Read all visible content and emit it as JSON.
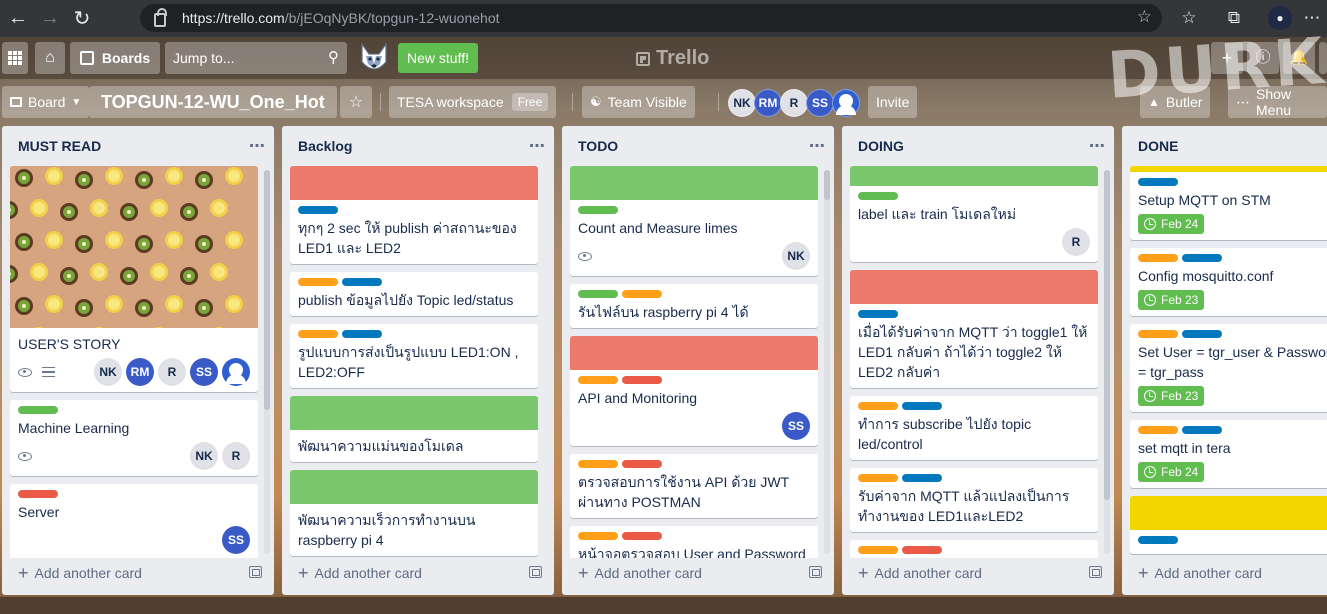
{
  "browser": {
    "url_host": "https://trello.com",
    "url_path": "/b/jEOqNyBK/topgun-12-wuonehot",
    "back_icon": "arrow-left-icon",
    "forward_icon": "arrow-right-icon",
    "reload_icon": "reload-icon"
  },
  "header": {
    "boards_label": "Boards",
    "jump_placeholder": "Jump to...",
    "new_stuff_label": "New stuff!",
    "logo_text": "Trello",
    "background_text": "DURKA"
  },
  "board": {
    "board_menu_label": "Board",
    "title": "TOPGUN-12-WU_One_Hot",
    "workspace_label": "TESA workspace",
    "plan_badge": "Free",
    "visibility_label": "Team Visible",
    "members": [
      "NK",
      "RM",
      "R",
      "SS"
    ],
    "invite_label": "Invite",
    "butler_label": "Butler",
    "show_menu_label": "Show Menu"
  },
  "colors": {
    "green": "#61bd4f",
    "red": "#eb5a46",
    "orange": "#ff9f1a",
    "blue": "#0079bf",
    "yellow": "#f2d600",
    "lightgreen": "#7bc86c",
    "salmon": "#ef7564"
  },
  "add_card_label": "Add another card",
  "lists": [
    {
      "title": "MUST READ",
      "cards": [
        {
          "title": "USER'S STORY",
          "members": [
            "NK",
            "RM",
            "R",
            "SS"
          ]
        },
        {
          "title": "Machine Learning",
          "members": [
            "NK",
            "R"
          ]
        },
        {
          "title": "Server",
          "members": [
            "SS"
          ]
        }
      ]
    },
    {
      "title": "Backlog",
      "cards": [
        {
          "title": "ทุกๆ 2 sec ให้ publish ค่าสถานะของ LED1 และ LED2"
        },
        {
          "title": "publish ข้อมูลไปยัง Topic led/status"
        },
        {
          "title": "รูปแบบการส่งเป็นรูปแบบ LED1:ON , LED2:OFF"
        },
        {
          "title": "พัฒนาความแม่นของโมเดล"
        },
        {
          "title": "พัฒนาความเร็วการทำงานบน raspberry pi 4"
        }
      ]
    },
    {
      "title": "TODO",
      "cards": [
        {
          "title": "Count and Measure limes",
          "members": [
            "NK"
          ]
        },
        {
          "title": "รันไฟล์บน raspberry pi 4 ได้"
        },
        {
          "title": "API and Monitoring",
          "members": [
            "SS"
          ]
        },
        {
          "title": "ตรวจสอบการใช้งาน API ด้วย JWT ผ่านทาง POSTMAN"
        },
        {
          "title": "หน้าจอตรวจสอบ User and Password"
        }
      ]
    },
    {
      "title": "DOING",
      "cards": [
        {
          "title": "label และ train โมเดลใหม่",
          "members": [
            "R"
          ]
        },
        {
          "title": "เมื่อได้รับค่าจาก MQTT ว่า toggle1 ให้ LED1 กลับค่า ถ้าได้ว่า toggle2 ให้ LED2 กลับค่า"
        },
        {
          "title": "ทำการ subscribe ไปยัง topic led/control"
        },
        {
          "title": "รับค่าจาก MQTT แล้วแปลงเป็นการทำงานของ LED1และLED2"
        }
      ]
    },
    {
      "title": "DONE",
      "cards": [
        {
          "title": "Setup MQTT on STM",
          "due": "Feb 24"
        },
        {
          "title": "Config mosquitto.conf",
          "due": "Feb 23"
        },
        {
          "title": "Set User = tgr_user & Password = tgr_pass",
          "due": "Feb 23"
        },
        {
          "title": "set mqtt in tera",
          "due": "Feb 24"
        }
      ]
    }
  ]
}
